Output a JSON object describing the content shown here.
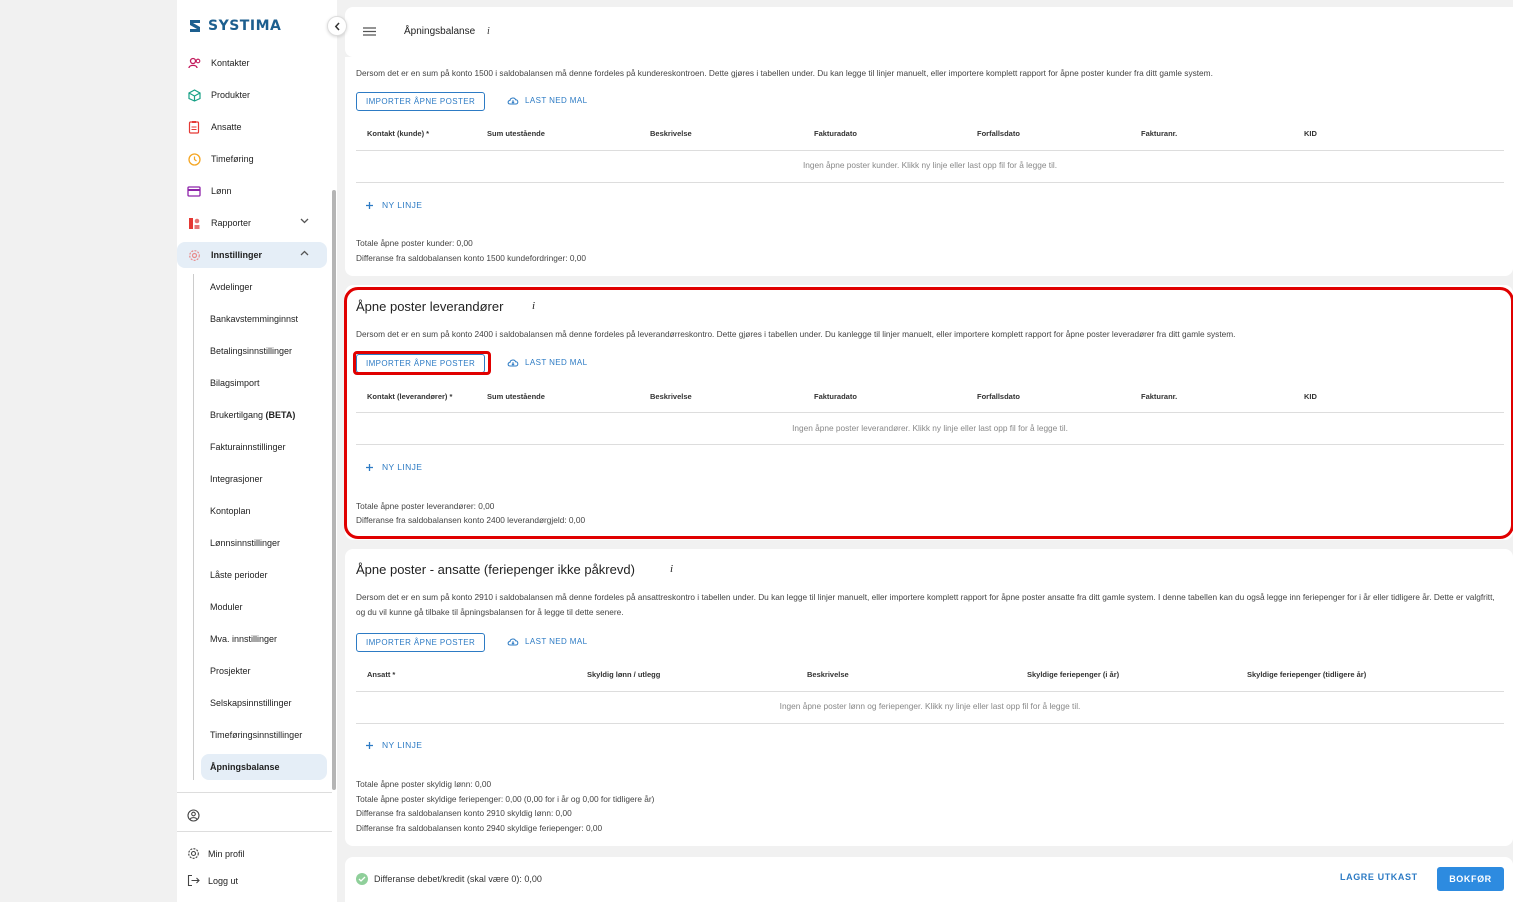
{
  "app": {
    "logo_text": "SYSTIMA"
  },
  "sidebar": {
    "items": [
      {
        "label": "Kontakter",
        "icon": "contacts-icon"
      },
      {
        "label": "Produkter",
        "icon": "cube-icon"
      },
      {
        "label": "Ansatte",
        "icon": "badge-icon"
      },
      {
        "label": "Timeføring",
        "icon": "clock-icon"
      },
      {
        "label": "Lønn",
        "icon": "card-icon"
      },
      {
        "label": "Rapporter",
        "icon": "report-icon"
      },
      {
        "label": "Innstillinger",
        "icon": "gear-icon"
      }
    ],
    "settings_items": [
      "Avdelinger",
      "Bankavstemminginnst",
      "Betalingsinnstillinger",
      "Bilagsimport",
      "Brukertilgang ",
      "Fakturainnstillinger",
      "Integrasjoner",
      "Kontoplan",
      "Lønnsinnstillinger",
      "Låste perioder",
      "Moduler",
      "Mva. innstillinger",
      "Prosjekter",
      "Selskapsinnstillinger",
      "Timeføringsinnstillinger",
      "Åpningsbalanse"
    ],
    "beta_label": "(BETA)",
    "profile_label": "Min profil",
    "logout_label": "Logg ut"
  },
  "header": {
    "title": "Åpningsbalanse",
    "info": "i"
  },
  "customers": {
    "desc": "Dersom det er en sum på konto 1500 i saldobalansen må denne fordeles på kundereskontroen. Dette gjøres i tabellen under. Du kan legge til linjer manuelt, eller importere komplett rapport for åpne poster kunder fra ditt gamle system.",
    "import_label": "IMPORTER ÅPNE POSTER",
    "download_label": "LAST NED MAL",
    "columns": [
      "Kontakt (kunde) *",
      "Sum utestående",
      "Beskrivelse",
      "Fakturadato",
      "Forfallsdato",
      "Fakturanr.",
      "KID"
    ],
    "empty": "Ingen åpne poster kunder. Klikk ny linje eller last opp fil for å legge til.",
    "new_line": "NY LINJE",
    "total1": "Totale åpne poster kunder: 0,00",
    "total2": "Differanse fra saldobalansen konto 1500 kundefordringer: 0,00"
  },
  "suppliers": {
    "title": "Åpne poster leverandører",
    "info": "i",
    "desc": "Dersom det er en sum på konto 2400 i saldobalansen må denne fordeles på leverandørreskontro. Dette gjøres i tabellen under. Du kanlegge til linjer manuelt, eller importere komplett rapport for åpne poster leveradører fra ditt gamle system.",
    "import_label": "IMPORTER ÅPNE POSTER",
    "download_label": "LAST NED MAL",
    "columns": [
      "Kontakt (leverandører) *",
      "Sum utestående",
      "Beskrivelse",
      "Fakturadato",
      "Forfallsdato",
      "Fakturanr.",
      "KID"
    ],
    "empty": "Ingen åpne poster leverandører. Klikk ny linje eller last opp fil for å legge til.",
    "new_line": "NY LINJE",
    "total1": "Totale åpne poster leverandører: 0,00",
    "total2": "Differanse fra saldobalansen konto 2400 leverandørgjeld: 0,00"
  },
  "employees": {
    "title": "Åpne poster - ansatte (feriepenger ikke påkrevd)",
    "info": "i",
    "desc": "Dersom det er en sum på konto 2910 i saldobalansen må denne fordeles på ansattreskontro i tabellen under. Du kan legge til linjer manuelt, eller importere komplett rapport for åpne poster ansatte fra ditt gamle system. I denne tabellen kan du også legge inn feriepenger for i år eller tidligere år. Dette er valgfritt, og du vil kunne gå tilbake til åpningsbalansen for å legge til dette senere.",
    "import_label": "IMPORTER ÅPNE POSTER",
    "download_label": "LAST NED MAL",
    "columns": [
      "Ansatt *",
      "Skyldig lønn / utlegg",
      "Beskrivelse",
      "Skyldige feriepenger (i år)",
      "Skyldige feriepenger (tidligere år)"
    ],
    "empty": "Ingen åpne poster lønn og feriepenger. Klikk ny linje eller last opp fil for å legge til.",
    "new_line": "NY LINJE",
    "total1": "Totale åpne poster skyldig lønn: 0,00",
    "total2": "Totale åpne poster skyldige feriepenger: 0,00 (0,00 for i år og 0,00 for tidligere år)",
    "total3": "Differanse fra saldobalansen konto 2910 skyldig lønn: 0,00",
    "total4": "Differanse fra saldobalansen konto 2940 skyldige feriepenger: 0,00"
  },
  "footer": {
    "status": "Differanse debet/kredit (skal være 0): 0,00",
    "save_draft": "LAGRE UTKAST",
    "book": "BOKFØR"
  },
  "colors": {
    "accent": "#2d7bc4",
    "highlight": "#e00000",
    "primary_button": "#2d8be0"
  }
}
